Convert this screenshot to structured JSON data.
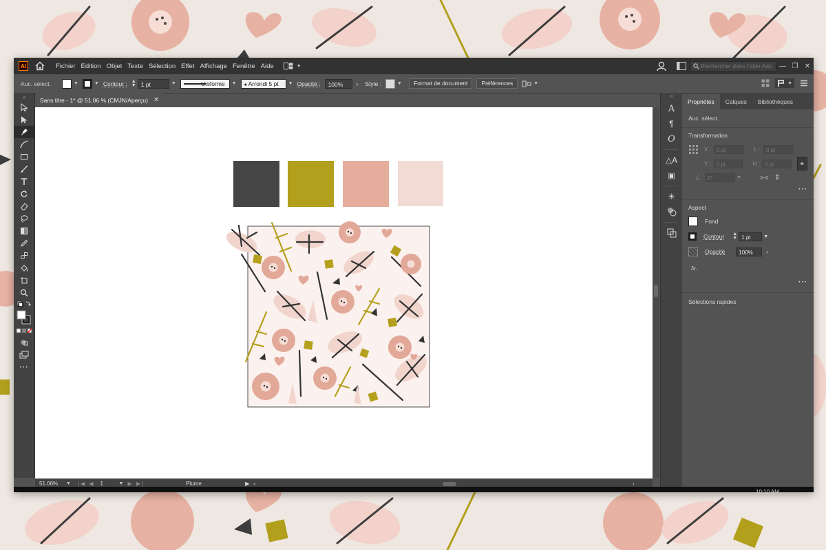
{
  "app": {
    "logo": "Ai",
    "menu": [
      "Fichier",
      "Edition",
      "Objet",
      "Texte",
      "Sélection",
      "Effet",
      "Affichage",
      "Fenêtre",
      "Aide"
    ],
    "search_placeholder": "Rechercher dans l'aide Adobe"
  },
  "controlbar": {
    "selection_label": "Auc. sélect.",
    "stroke_label": "Contour :",
    "stroke_weight": "1 pt",
    "profile_label": "Uniforme",
    "brush_label": "Arrondi 5 pt",
    "opacity_label": "Opacité :",
    "opacity_value": "100%",
    "style_label": "Style :",
    "doc_setup_label": "Format de document",
    "prefs_label": "Préférences"
  },
  "document": {
    "tab_title": "Sans titre - 1* @ 51.06 % (CMJN/Aperçu)"
  },
  "swatches": [
    {
      "name": "charcoal",
      "color": "#454545"
    },
    {
      "name": "mustard",
      "color": "#b29f1c"
    },
    {
      "name": "salmon-pink",
      "color": "#e5ad9c"
    },
    {
      "name": "blush",
      "color": "#f3dbd5"
    }
  ],
  "status": {
    "zoom": "51.06%",
    "artboard_number": "1",
    "tool_name": "Plume"
  },
  "panel": {
    "tabs": [
      "Propriétés",
      "Calques",
      "Bibliothèques"
    ],
    "selection": "Auc. sélect.",
    "transform_title": "Transformation",
    "x_label": "X :",
    "y_label": "Y :",
    "w_label": "L :",
    "h_label": "H :",
    "zero_value": "0 pt",
    "angle_value": "0°",
    "appearance_title": "Aspect",
    "fill_label": "Fond",
    "stroke_label": "Contour",
    "stroke_value": "1 pt",
    "opacity_label": "Opacité",
    "opacity_value": "100%",
    "fx_label": "fx.",
    "quick_actions": "Sélections rapides"
  },
  "taskbar": {
    "clock": "10:10 AM"
  }
}
